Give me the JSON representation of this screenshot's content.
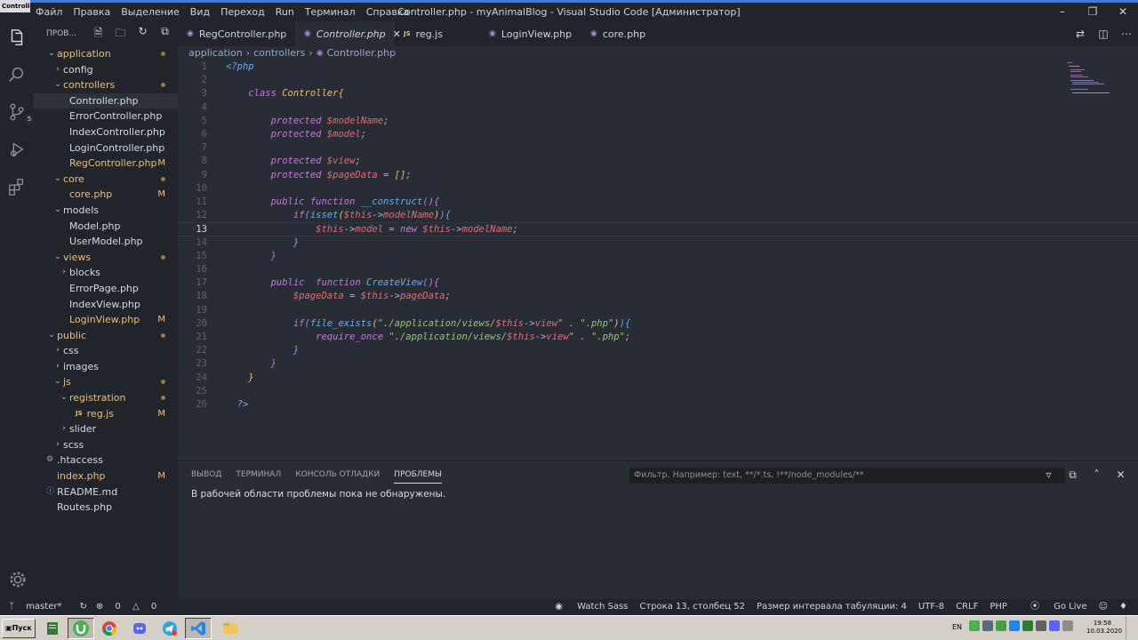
{
  "app": {
    "window_title": "Controller.php - myAnimalBlog - Visual Studio Code [Администратор]",
    "app_chip": "Controlle",
    "menu": [
      "Файл",
      "Правка",
      "Выделение",
      "Вид",
      "Переход",
      "Run",
      "Терминал",
      "Справка"
    ]
  },
  "activity": {
    "scm_badge": "5"
  },
  "sidebar": {
    "header": "ПРОВ..."
  },
  "tabs": [
    {
      "label": "RegController.php",
      "icon": "php-elephant-icon"
    },
    {
      "label": "Controller.php",
      "icon": "php-elephant-icon",
      "active": true
    },
    {
      "label": "reg.js",
      "icon": "js-icon",
      "badge": "JS"
    },
    {
      "label": "LoginView.php",
      "icon": "php-elephant-icon"
    },
    {
      "label": "core.php",
      "icon": "php-elephant-icon"
    }
  ],
  "breadcrumb": [
    "application",
    "controllers",
    "Controller.php"
  ],
  "editor": {
    "line_numbers": [
      "1",
      "2",
      "3",
      "4",
      "5",
      "6",
      "7",
      "8",
      "9",
      "10",
      "11",
      "12",
      "13",
      "14",
      "15",
      "16",
      "17",
      "18",
      "19",
      "20",
      "21",
      "22",
      "23",
      "24",
      "25",
      "26"
    ],
    "current_line": "13"
  },
  "panel": {
    "tabs": [
      "ВЫВОД",
      "ТЕРМИНАЛ",
      "КОНСОЛЬ ОТЛАДКИ",
      "ПРОБЛЕМЫ"
    ],
    "filter_placeholder": "Фильтр. Например: text, **/*.ts, !**/node_modules/**",
    "message": "В рабочей области проблемы пока не обнаружены."
  },
  "status": {
    "branch": "master*",
    "errors": "0",
    "warnings": "0",
    "watch_sass": "Watch Sass",
    "position": "Строка 13, столбец 52",
    "indent": "Размер интервала табуляции: 4",
    "encoding": "UTF-8",
    "eol": "CRLF",
    "language": "PHP",
    "go_live": "Go Live"
  },
  "taskbar": {
    "start": "Пуск",
    "lang": "EN",
    "time": "19:58",
    "date": "10.03.2020"
  },
  "colors": {
    "keyword": "#c678dd",
    "variable": "#e06c75",
    "function": "#61afef",
    "class": "#e5c07b",
    "string": "#98c379",
    "modified": "#e5c07b"
  }
}
